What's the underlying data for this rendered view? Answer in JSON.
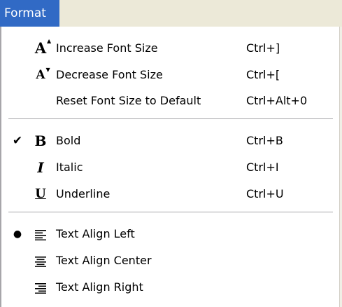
{
  "menubar": {
    "format_label": "Format"
  },
  "menu": {
    "items": [
      {
        "label": "Increase Font Size",
        "shortcut": "Ctrl+]",
        "icon": "increase-font-icon"
      },
      {
        "label": "Decrease Font Size",
        "shortcut": "Ctrl+[",
        "icon": "decrease-font-icon"
      },
      {
        "label": "Reset Font Size to Default",
        "shortcut": "Ctrl+Alt+0"
      },
      {
        "label": "Bold",
        "shortcut": "Ctrl+B",
        "icon": "bold-icon",
        "checked": true,
        "check_glyph": "✔"
      },
      {
        "label": "Italic",
        "shortcut": "Ctrl+I",
        "icon": "italic-icon"
      },
      {
        "label": "Underline",
        "shortcut": "Ctrl+U",
        "icon": "underline-icon"
      },
      {
        "label": "Text Align Left",
        "icon": "align-left-icon",
        "selected": true,
        "check_glyph": "●"
      },
      {
        "label": "Text Align Center",
        "icon": "align-center-icon"
      },
      {
        "label": "Text Align Right",
        "icon": "align-right-icon"
      }
    ]
  },
  "colors": {
    "highlight": "#316ac5",
    "menu_bg": "#ffffff",
    "bar_bg": "#ece9d8"
  }
}
